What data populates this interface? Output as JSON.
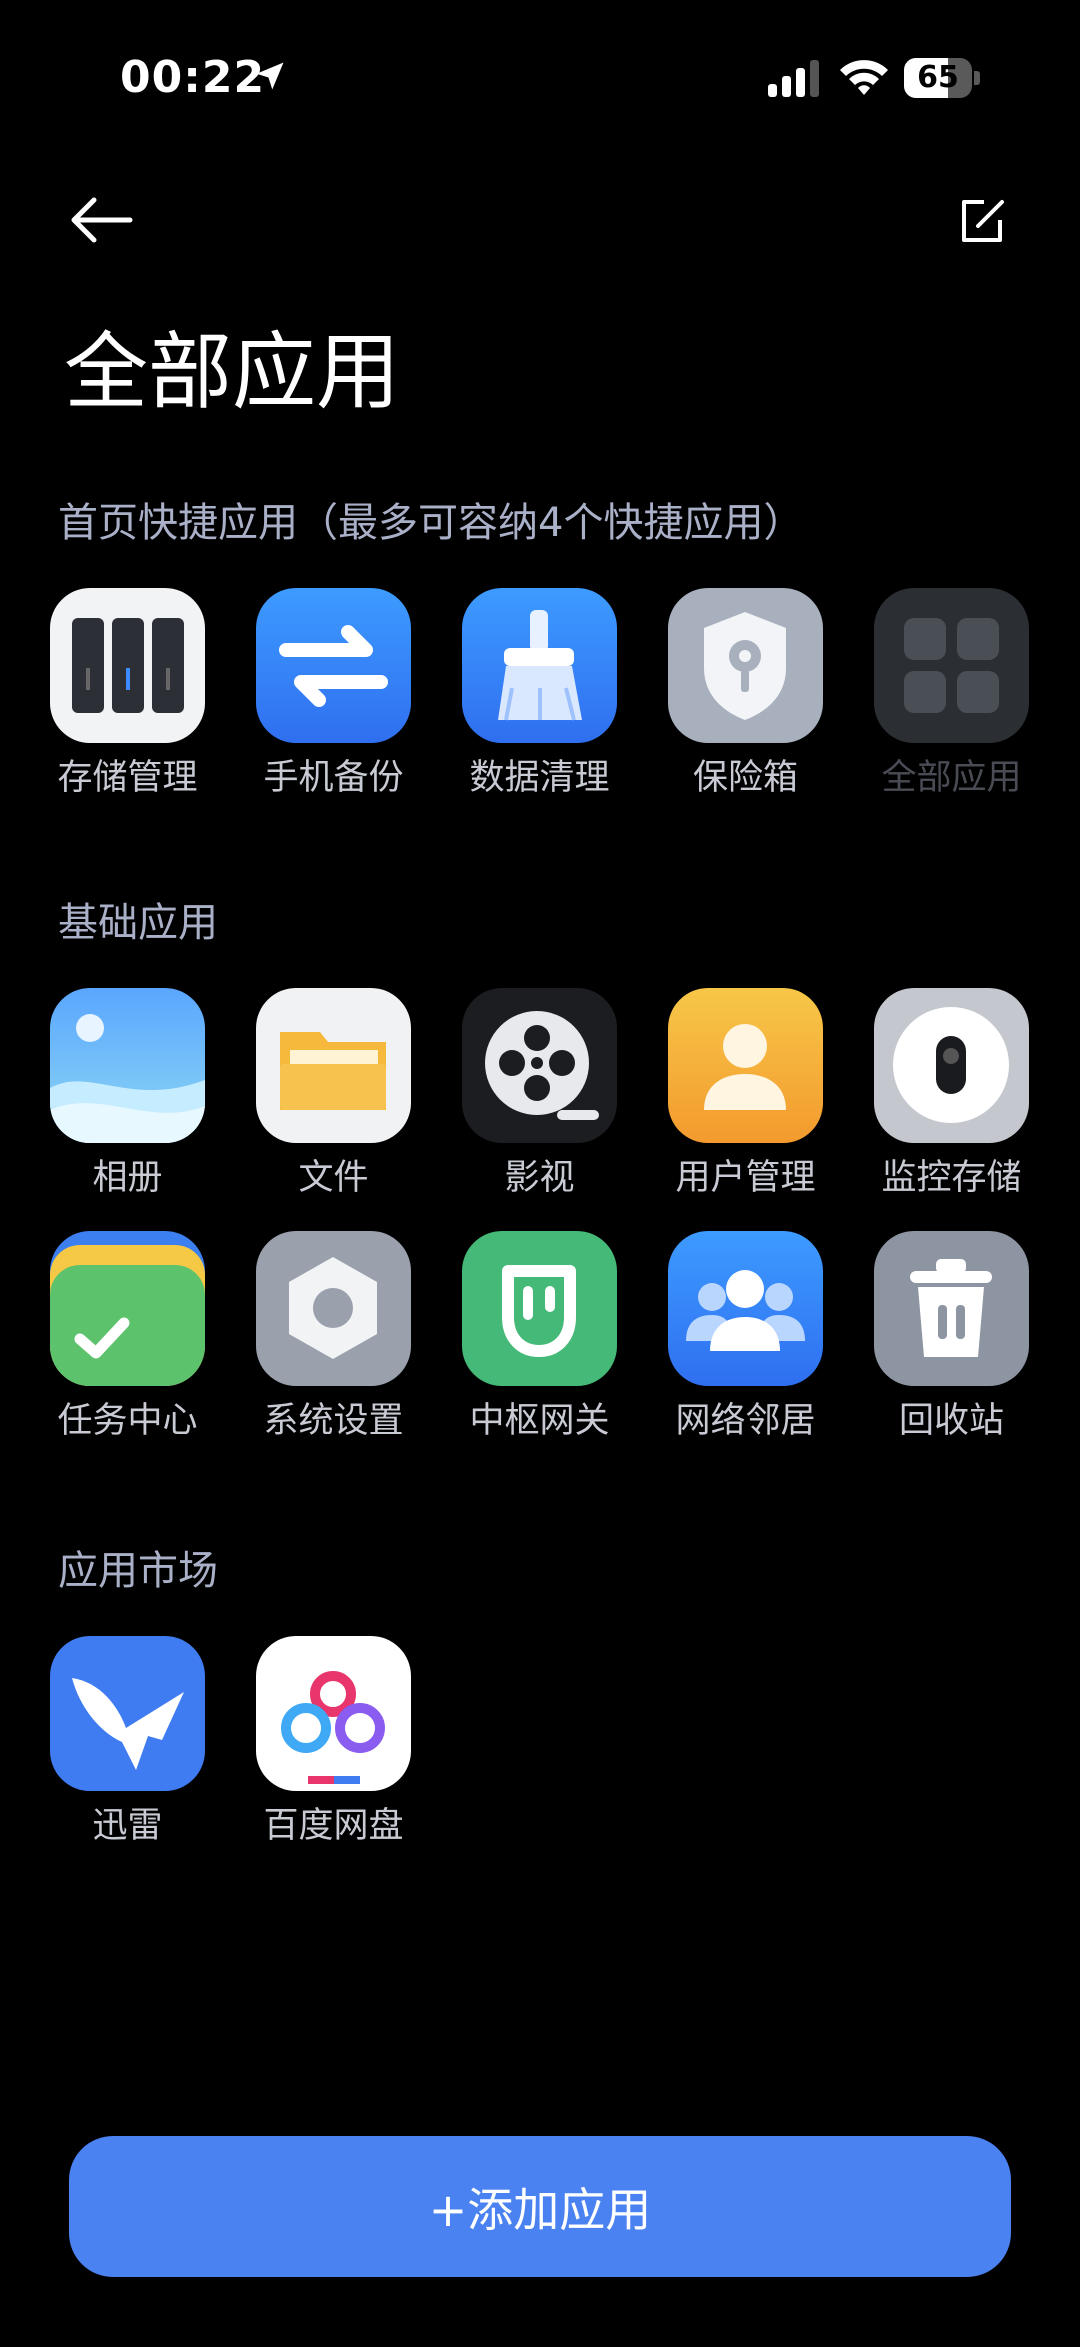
{
  "status_bar": {
    "time": "00:22",
    "battery": "65"
  },
  "header": {
    "title": "全部应用"
  },
  "sections": {
    "quick": {
      "title": "首页快捷应用（最多可容纳4个快捷应用）",
      "apps": [
        {
          "label": "存储管理",
          "icon": "storage-icon"
        },
        {
          "label": "手机备份",
          "icon": "phone-backup-icon"
        },
        {
          "label": "数据清理",
          "icon": "broom-icon"
        },
        {
          "label": "保险箱",
          "icon": "safe-shield-icon"
        },
        {
          "label": "全部应用",
          "icon": "all-apps-grid-icon"
        }
      ]
    },
    "basic": {
      "title": "基础应用",
      "apps": [
        {
          "label": "相册",
          "icon": "photo-album-icon"
        },
        {
          "label": "文件",
          "icon": "folder-icon"
        },
        {
          "label": "影视",
          "icon": "film-reel-icon"
        },
        {
          "label": "用户管理",
          "icon": "user-icon"
        },
        {
          "label": "监控存储",
          "icon": "camera-icon"
        },
        {
          "label": "任务中心",
          "icon": "task-check-icon"
        },
        {
          "label": "系统设置",
          "icon": "settings-nut-icon"
        },
        {
          "label": "中枢网关",
          "icon": "mi-gateway-icon"
        },
        {
          "label": "网络邻居",
          "icon": "network-users-icon"
        },
        {
          "label": "回收站",
          "icon": "trash-icon"
        }
      ]
    },
    "market": {
      "title": "应用市场",
      "apps": [
        {
          "label": "迅雷",
          "icon": "thunder-bird-icon"
        },
        {
          "label": "百度网盘",
          "icon": "baidu-cloud-icon"
        }
      ]
    }
  },
  "add_button": {
    "label": "+添加应用"
  },
  "colors": {
    "accent": "#4b82f2",
    "background": "#000000",
    "section_title": "#aab0c8"
  }
}
